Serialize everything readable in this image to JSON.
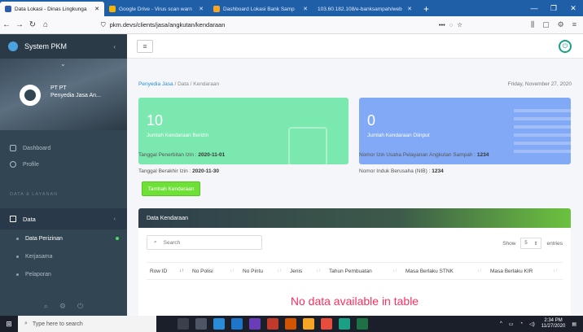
{
  "browser": {
    "tabs": [
      {
        "label": "Data Lokasi - Dinas Lingkunga",
        "active": true,
        "color": "#2a5db0"
      },
      {
        "label": "Google Drive - Virus scan warn",
        "active": false,
        "color": "#f4b400"
      },
      {
        "label": "Dashboard Lokasi Bank Samp",
        "active": false,
        "color": "#f6a623"
      },
      {
        "label": "103.60.182.108/e-banksampah/web",
        "active": false,
        "color": "#999999"
      }
    ],
    "url": "pkm.devs/clients/jasa/angkutan/kendaraan",
    "url_dots": "•••"
  },
  "sidebar": {
    "brand": "System PKM",
    "user_line1": "PT PT",
    "user_line2": "Penyedia Jasa An...",
    "items": [
      {
        "label": "Dashboard"
      },
      {
        "label": "Profile"
      }
    ],
    "section": "DATA & LAYANAN",
    "data_label": "Data",
    "sub_items": [
      {
        "label": "Data Perizinan",
        "active": true
      },
      {
        "label": "Kerjasama",
        "active": false
      },
      {
        "label": "Pelaporan",
        "active": false
      }
    ]
  },
  "breadcrumb": {
    "root": "Penyedia Jasa",
    "sep": "/",
    "mid": "Data",
    "current": "Kendaraan"
  },
  "date": "Friday, November 27, 2020",
  "cards": [
    {
      "value": "10",
      "label": "Jumlah Kendaraan Berizin",
      "color": "#7be8b0"
    },
    {
      "value": "0",
      "label": "Jumlah Kendaraan Diinput",
      "color": "#82a9f5"
    }
  ],
  "info": {
    "tgl_terbit_label": "Tanggal Penerbitan Izin :",
    "tgl_terbit": "2020-11-01",
    "tgl_akhir_label": "Tanggal Berakhir Izin :",
    "tgl_akhir": "2020-11-30",
    "no_izin_label": "Nomor Izin Usaha Pelayanan Angkutan Sampah :",
    "no_izin": "1234",
    "nib_label": "Nomor Induk Berusaha (NIB) :",
    "nib": "1234"
  },
  "add_button": "Tambah Kendaraan",
  "table": {
    "title": "Data Kendaraan",
    "search_placeholder": "Search",
    "show_label": "Show",
    "show_value": "5",
    "entries_label": "entries",
    "columns": [
      "Row ID",
      "No Polisi",
      "No Pintu",
      "Jenis",
      "Tahun Pembuatan",
      "Masa Berlaku STNK",
      "Masa Berlaku KIR"
    ],
    "empty_text": "No data available in table"
  },
  "taskbar": {
    "search_placeholder": "Type here to search",
    "time": "2:34 PM",
    "date": "11/27/2020"
  }
}
